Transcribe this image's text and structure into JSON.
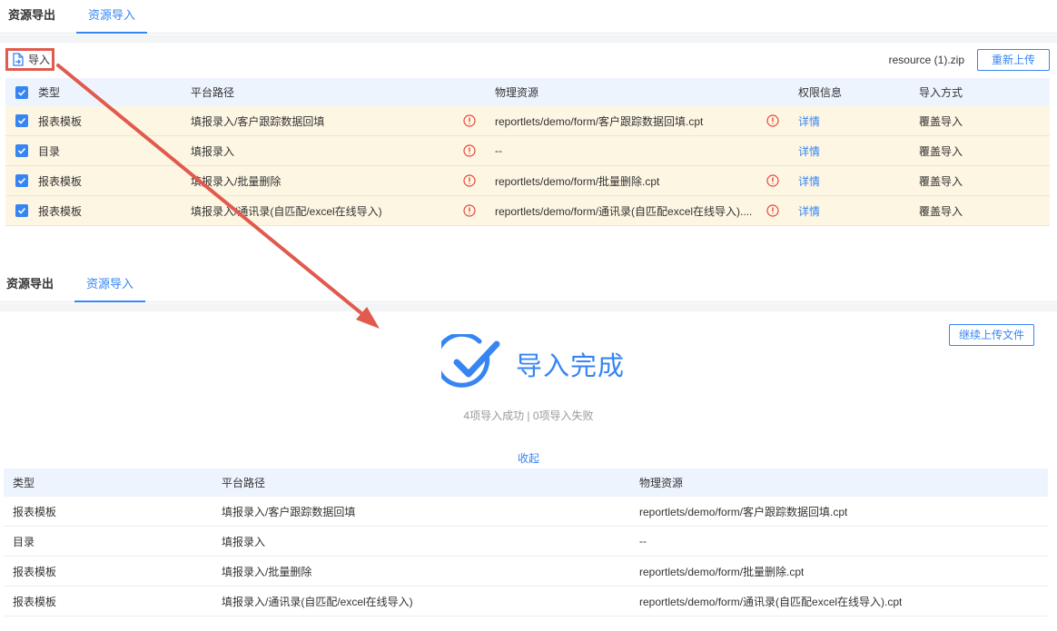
{
  "tabs_top": [
    {
      "label": "资源导出",
      "active": false
    },
    {
      "label": "资源导入",
      "active": true
    }
  ],
  "toolbar": {
    "import_label": "导入",
    "filename": "resource (1).zip",
    "reupload_label": "重新上传"
  },
  "preview_table": {
    "headers": {
      "type": "类型",
      "path": "平台路径",
      "resource": "物理资源",
      "permission": "权限信息",
      "method": "导入方式"
    },
    "rows": [
      {
        "type": "报表模板",
        "path": "填报录入/客户跟踪数据回填",
        "resource": "reportlets/demo/form/客户跟踪数据回填.cpt",
        "permission": "详情",
        "method": "覆盖导入",
        "res_warn": true
      },
      {
        "type": "目录",
        "path": "填报录入",
        "resource": "--",
        "permission": "详情",
        "method": "覆盖导入",
        "res_warn": false
      },
      {
        "type": "报表模板",
        "path": "填报录入/批量删除",
        "resource": "reportlets/demo/form/批量删除.cpt",
        "permission": "详情",
        "method": "覆盖导入",
        "res_warn": true
      },
      {
        "type": "报表模板",
        "path": "填报录入/通讯录(自匹配/excel在线导入)",
        "resource": "reportlets/demo/form/通讯录(自匹配excel在线导入)....",
        "permission": "详情",
        "method": "覆盖导入",
        "res_warn": true
      }
    ]
  },
  "tabs_bottom": [
    {
      "label": "资源导出",
      "active": false
    },
    {
      "label": "资源导入",
      "active": true
    }
  ],
  "result": {
    "continue_label": "继续上传文件",
    "title": "导入完成",
    "summary": "4项导入成功 | 0项导入失败",
    "collapse_label": "收起"
  },
  "result_table": {
    "headers": {
      "type": "类型",
      "path": "平台路径",
      "resource": "物理资源"
    },
    "rows": [
      {
        "type": "报表模板",
        "path": "填报录入/客户跟踪数据回填",
        "resource": "reportlets/demo/form/客户跟踪数据回填.cpt"
      },
      {
        "type": "目录",
        "path": "填报录入",
        "resource": "--"
      },
      {
        "type": "报表模板",
        "path": "填报录入/批量删除",
        "resource": "reportlets/demo/form/批量删除.cpt"
      },
      {
        "type": "报表模板",
        "path": "填报录入/通讯录(自匹配/excel在线导入)",
        "resource": "reportlets/demo/form/通讯录(自匹配excel在线导入).cpt"
      }
    ]
  },
  "colors": {
    "accent": "#3685f2",
    "highlight_row": "#fdf6e3",
    "header_row": "#eef4fe",
    "warning": "#e8453c",
    "annotation": "#e05a4e"
  },
  "icons": {
    "import": "file-import-icon",
    "warning": "info-warning-icon",
    "checkbox": "checkbox-checked-icon",
    "success": "circle-check-icon"
  }
}
